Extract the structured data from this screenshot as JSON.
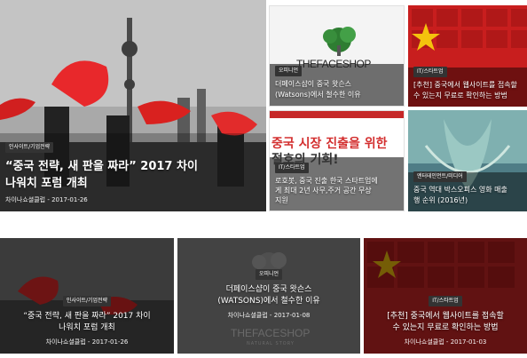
{
  "articles": [
    {
      "category": "인사이트/기업전략",
      "title_line1": "“중국 전략, 새 판을 짜라” 2017 차이",
      "title_line2": "나워치 포럼 개최",
      "author": "차이나쇼셜클럽",
      "date": "2017-01-26",
      "color": "#e8282b"
    },
    {
      "category": "오피니언",
      "title_line1": "더페이스샵이 중국 왓슨스",
      "title_line2": "(Watsons)에서 철수한 이유",
      "brand": "THEFACESHOP",
      "brand_sub": "NATURAL STORY"
    },
    {
      "category": "IT/스타트업",
      "title_line1": "[추천] 중국에서 웹사이트를 접속할",
      "title_line2": "수 있는지 무료로 확인하는 방법",
      "color": "#d9211f"
    },
    {
      "category": "IT/스타트업",
      "title_line1": "로호봇, 중국 진출 한국 스타트업에",
      "title_line2": "게 최대 2년 사무,주거 공간 무상",
      "title_line3": "지원",
      "banner_text_1": "중국 시장 진출을 위한",
      "banner_text_2": "절호의 기회!"
    },
    {
      "category": "엔터테인먼트/미디어",
      "title_line1": "중국 역대 박스오피스 영화 매출",
      "title_line2": "행 순위 (2016년)"
    }
  ],
  "bottom_row": [
    {
      "category": "인사이트/기업전략",
      "title_line1": "“중국 전략, 새 판을 짜라” 2017 차이",
      "title_line2": "나워치 포럼 개최",
      "author": "차이나쇼셜클럽",
      "date": "2017-01-26"
    },
    {
      "category": "오피니언",
      "title_line1": "더페이스샵이 중국 왓슨스",
      "title_line2": "(WATSONS)에서 철수한 이유",
      "author": "차이나쇼셜클럽",
      "date": "2017-01-08",
      "brand": "THEFACESHOP",
      "brand_sub": "NATURAL STORY"
    },
    {
      "category": "IT/스타트업",
      "title_line1": "[추천] 중국에서 웹사이트를 접속할",
      "title_line2": "수 있는지 무료로 확인하는 방법",
      "author": "차이나쇼셜클럽",
      "date": "2017-01-03"
    }
  ],
  "separator": " - "
}
